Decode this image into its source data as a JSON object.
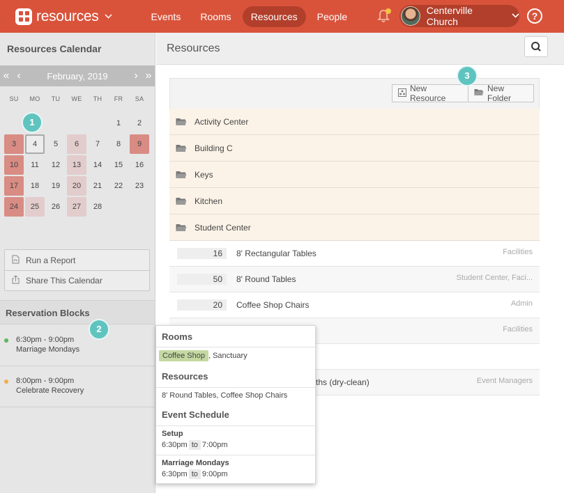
{
  "app": {
    "name": "resources"
  },
  "nav": {
    "items": [
      "Events",
      "Rooms",
      "Resources",
      "People"
    ],
    "active": "Resources"
  },
  "account": {
    "name": "Centerville Church"
  },
  "help": {
    "label": "?"
  },
  "sidebar": {
    "title": "Resources Calendar",
    "calendar": {
      "month": "February, 2019",
      "nav_first": "«",
      "nav_prev": "‹",
      "nav_next": "›",
      "nav_last": "»",
      "dow": [
        "SU",
        "MO",
        "TU",
        "WE",
        "TH",
        "FR",
        "SA"
      ],
      "days": [
        {
          "n": "",
          "h": ""
        },
        {
          "n": "",
          "h": ""
        },
        {
          "n": "",
          "h": ""
        },
        {
          "n": "",
          "h": ""
        },
        {
          "n": "",
          "h": ""
        },
        {
          "n": "1",
          "h": ""
        },
        {
          "n": "2",
          "h": ""
        },
        {
          "n": "3",
          "h": "h2"
        },
        {
          "n": "4",
          "h": "today"
        },
        {
          "n": "5",
          "h": ""
        },
        {
          "n": "6",
          "h": "h1"
        },
        {
          "n": "7",
          "h": ""
        },
        {
          "n": "8",
          "h": ""
        },
        {
          "n": "9",
          "h": "h2"
        },
        {
          "n": "10",
          "h": "h2"
        },
        {
          "n": "11",
          "h": ""
        },
        {
          "n": "12",
          "h": ""
        },
        {
          "n": "13",
          "h": "h1"
        },
        {
          "n": "14",
          "h": ""
        },
        {
          "n": "15",
          "h": ""
        },
        {
          "n": "16",
          "h": ""
        },
        {
          "n": "17",
          "h": "h2"
        },
        {
          "n": "18",
          "h": ""
        },
        {
          "n": "19",
          "h": ""
        },
        {
          "n": "20",
          "h": "h1"
        },
        {
          "n": "21",
          "h": ""
        },
        {
          "n": "22",
          "h": ""
        },
        {
          "n": "23",
          "h": ""
        },
        {
          "n": "24",
          "h": "h2"
        },
        {
          "n": "25",
          "h": "h1"
        },
        {
          "n": "26",
          "h": ""
        },
        {
          "n": "27",
          "h": "h1"
        },
        {
          "n": "28",
          "h": ""
        }
      ]
    },
    "actions": {
      "run_report": "Run a Report",
      "share_calendar": "Share This Calendar"
    },
    "reservation_blocks": {
      "title": "Reservation Blocks",
      "items": [
        {
          "time": "6:30pm - 9:00pm",
          "name": "Marriage Mondays",
          "color": "#5cb85c"
        },
        {
          "time": "8:00pm - 9:00pm",
          "name": "Celebrate Recovery",
          "color": "#f0ad4e"
        }
      ]
    }
  },
  "main": {
    "title": "Resources",
    "toolbar": {
      "new_resource": "New Resource",
      "new_folder": "New Folder"
    },
    "folders": [
      "Activity Center",
      "Building C",
      "Keys",
      "Kitchen",
      "Student Center"
    ],
    "resources": [
      {
        "qty": "16",
        "name": "8' Rectangular Tables",
        "category": "Facilities"
      },
      {
        "qty": "50",
        "name": "8' Round Tables",
        "category": "Student Center, Faci..."
      },
      {
        "qty": "20",
        "name": "Coffee Shop Chairs",
        "category": "Admin"
      },
      {
        "qty": "",
        "name": "",
        "category": "Facilities"
      },
      {
        "qty": "",
        "name": "",
        "category": ""
      },
      {
        "qty": "",
        "name": "ths (dry-clean)",
        "category": "Event Managers"
      }
    ]
  },
  "popover": {
    "rooms_title": "Rooms",
    "room_highlight": "Coffee Shop",
    "room_rest": ", Sanctuary",
    "resources_title": "Resources",
    "resources_text": "8' Round Tables, Coffee Shop Chairs",
    "schedule_title": "Event Schedule",
    "schedule": [
      {
        "label": "Setup",
        "start": "6:30pm",
        "to": "to",
        "end": "7:00pm"
      },
      {
        "label": "Marriage Mondays",
        "start": "6:30pm",
        "to": "to",
        "end": "9:00pm"
      }
    ]
  },
  "badges": [
    "1",
    "2",
    "3"
  ]
}
